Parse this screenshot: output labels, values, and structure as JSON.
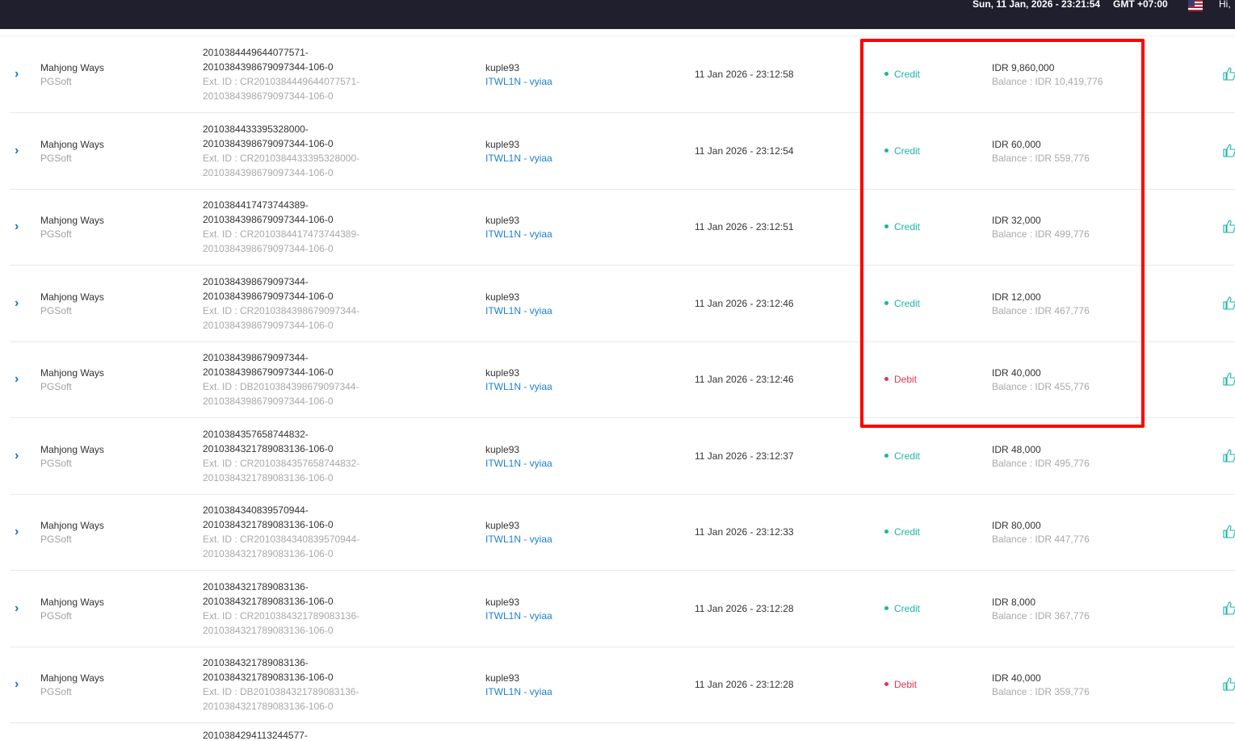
{
  "header": {
    "datetime": "Sun, 11 Jan, 2026 - 23:21:54",
    "timezone": "GMT +07:00",
    "greeting": "Hi,",
    "flag_icon": "us-flag-icon"
  },
  "rows": [
    {
      "game": "Mahjong Ways",
      "provider": "PGSoft",
      "tx_line1": "2010384449644077571-",
      "tx_line2": "2010384398679097344-106-0",
      "ext_line1": "Ext. ID : CR2010384449644077571-",
      "ext_line2": "2010384398679097344-106-0",
      "user": "kuple93",
      "agent": "ITWL1N - vyiaa",
      "date": "11 Jan 2026 - 23:12:58",
      "type": "Credit",
      "kind": "credit",
      "amount": "IDR 9,860,000",
      "balance": "Balance : IDR 10,419,776"
    },
    {
      "game": "Mahjong Ways",
      "provider": "PGSoft",
      "tx_line1": "2010384433395328000-",
      "tx_line2": "2010384398679097344-106-0",
      "ext_line1": "Ext. ID : CR2010384433395328000-",
      "ext_line2": "2010384398679097344-106-0",
      "user": "kuple93",
      "agent": "ITWL1N - vyiaa",
      "date": "11 Jan 2026 - 23:12:54",
      "type": "Credit",
      "kind": "credit",
      "amount": "IDR 60,000",
      "balance": "Balance : IDR 559,776"
    },
    {
      "game": "Mahjong Ways",
      "provider": "PGSoft",
      "tx_line1": "2010384417473744389-",
      "tx_line2": "2010384398679097344-106-0",
      "ext_line1": "Ext. ID : CR2010384417473744389-",
      "ext_line2": "2010384398679097344-106-0",
      "user": "kuple93",
      "agent": "ITWL1N - vyiaa",
      "date": "11 Jan 2026 - 23:12:51",
      "type": "Credit",
      "kind": "credit",
      "amount": "IDR 32,000",
      "balance": "Balance : IDR 499,776"
    },
    {
      "game": "Mahjong Ways",
      "provider": "PGSoft",
      "tx_line1": "2010384398679097344-",
      "tx_line2": "2010384398679097344-106-0",
      "ext_line1": "Ext. ID : CR2010384398679097344-",
      "ext_line2": "2010384398679097344-106-0",
      "user": "kuple93",
      "agent": "ITWL1N - vyiaa",
      "date": "11 Jan 2026 - 23:12:46",
      "type": "Credit",
      "kind": "credit",
      "amount": "IDR 12,000",
      "balance": "Balance : IDR 467,776"
    },
    {
      "game": "Mahjong Ways",
      "provider": "PGSoft",
      "tx_line1": "2010384398679097344-",
      "tx_line2": "2010384398679097344-106-0",
      "ext_line1": "Ext. ID : DB2010384398679097344-",
      "ext_line2": "2010384398679097344-106-0",
      "user": "kuple93",
      "agent": "ITWL1N - vyiaa",
      "date": "11 Jan 2026 - 23:12:46",
      "type": "Debit",
      "kind": "debit",
      "amount": "IDR 40,000",
      "balance": "Balance : IDR 455,776"
    },
    {
      "game": "Mahjong Ways",
      "provider": "PGSoft",
      "tx_line1": "2010384357658744832-",
      "tx_line2": "2010384321789083136-106-0",
      "ext_line1": "Ext. ID : CR2010384357658744832-",
      "ext_line2": "2010384321789083136-106-0",
      "user": "kuple93",
      "agent": "ITWL1N - vyiaa",
      "date": "11 Jan 2026 - 23:12:37",
      "type": "Credit",
      "kind": "credit",
      "amount": "IDR 48,000",
      "balance": "Balance : IDR 495,776"
    },
    {
      "game": "Mahjong Ways",
      "provider": "PGSoft",
      "tx_line1": "2010384340839570944-",
      "tx_line2": "2010384321789083136-106-0",
      "ext_line1": "Ext. ID : CR2010384340839570944-",
      "ext_line2": "2010384321789083136-106-0",
      "user": "kuple93",
      "agent": "ITWL1N - vyiaa",
      "date": "11 Jan 2026 - 23:12:33",
      "type": "Credit",
      "kind": "credit",
      "amount": "IDR 80,000",
      "balance": "Balance : IDR 447,776"
    },
    {
      "game": "Mahjong Ways",
      "provider": "PGSoft",
      "tx_line1": "2010384321789083136-",
      "tx_line2": "2010384321789083136-106-0",
      "ext_line1": "Ext. ID : CR2010384321789083136-",
      "ext_line2": "2010384321789083136-106-0",
      "user": "kuple93",
      "agent": "ITWL1N - vyiaa",
      "date": "11 Jan 2026 - 23:12:28",
      "type": "Credit",
      "kind": "credit",
      "amount": "IDR 8,000",
      "balance": "Balance : IDR 367,776"
    },
    {
      "game": "Mahjong Ways",
      "provider": "PGSoft",
      "tx_line1": "2010384321789083136-",
      "tx_line2": "2010384321789083136-106-0",
      "ext_line1": "Ext. ID : DB2010384321789083136-",
      "ext_line2": "2010384321789083136-106-0",
      "user": "kuple93",
      "agent": "ITWL1N - vyiaa",
      "date": "11 Jan 2026 - 23:12:28",
      "type": "Debit",
      "kind": "debit",
      "amount": "IDR 40,000",
      "balance": "Balance : IDR 359,776"
    }
  ],
  "partial_row_text": "2010384294113244577-",
  "icons": {
    "expand": "chevron-right-icon",
    "action": "thumbs-up-icon"
  },
  "colors": {
    "credit": "#1bb5a2",
    "debit": "#e2384c",
    "link": "#1a7fd6",
    "highlight": "#ff0000",
    "topbar": "#1f1f2e"
  }
}
